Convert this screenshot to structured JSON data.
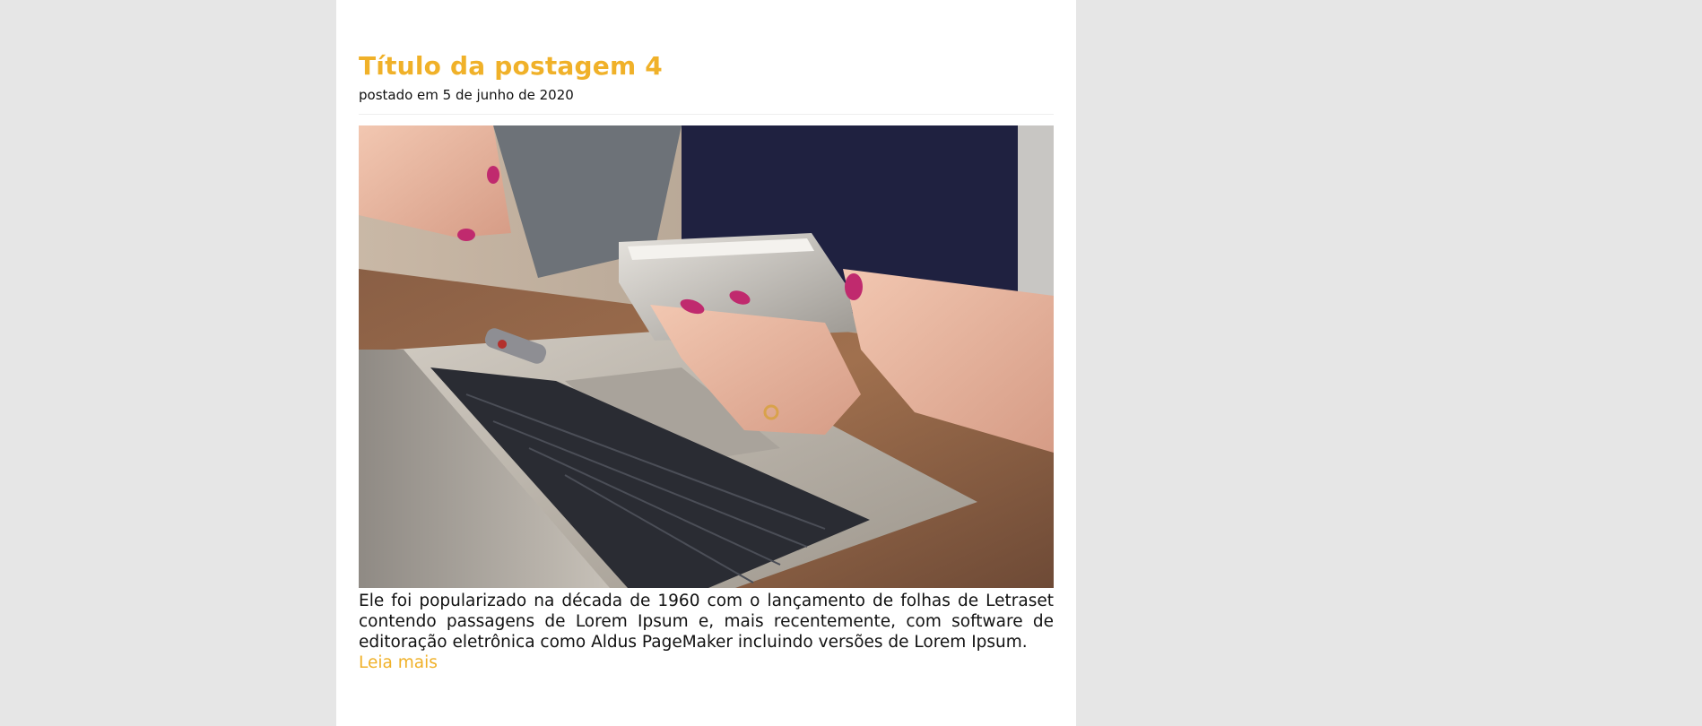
{
  "post": {
    "title": "Título da postagem 4",
    "meta": "postado em 5 de junho de 2020",
    "excerpt": "Ele foi popularizado na década de 1960 com o lançamento de folhas de Letraset contendo passagens de Lorem Ipsum e, mais recentemente, com software de editoração eletrônica como Aldus PageMaker incluindo versões de Lorem Ipsum.",
    "read_more": "Leia mais",
    "image_icon": "photo-laptop-smartphone"
  },
  "colors": {
    "accent": "#f0b129",
    "page_background": "#e6e6e6",
    "card_background": "#ffffff",
    "text": "#111111"
  }
}
